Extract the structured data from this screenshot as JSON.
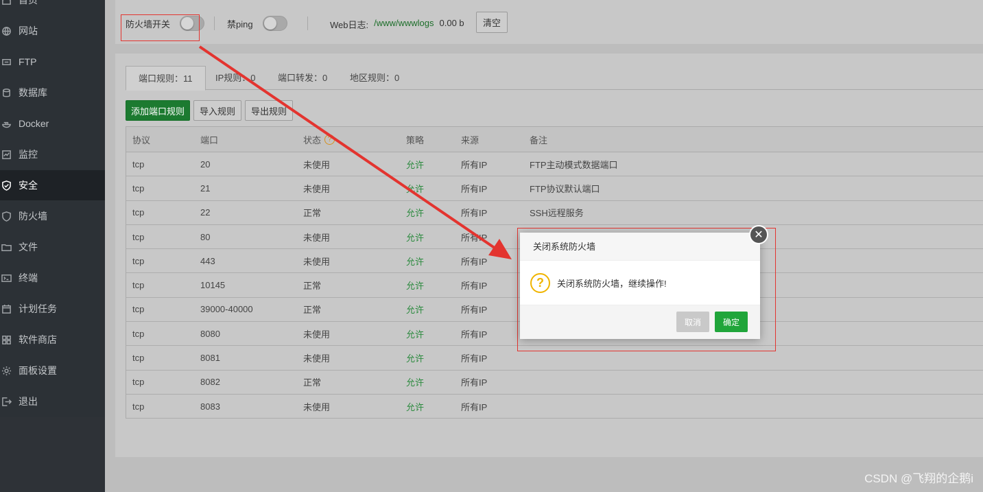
{
  "sidebar": {
    "items": [
      {
        "label": "首页",
        "icon": "home-icon"
      },
      {
        "label": "网站",
        "icon": "globe-icon"
      },
      {
        "label": "FTP",
        "icon": "ftp-icon"
      },
      {
        "label": "数据库",
        "icon": "database-icon"
      },
      {
        "label": "Docker",
        "icon": "docker-icon"
      },
      {
        "label": "监控",
        "icon": "monitor-icon"
      },
      {
        "label": "安全",
        "icon": "shield-check-icon"
      },
      {
        "label": "防火墙",
        "icon": "shield-icon"
      },
      {
        "label": "文件",
        "icon": "folder-icon"
      },
      {
        "label": "终端",
        "icon": "terminal-icon"
      },
      {
        "label": "计划任务",
        "icon": "calendar-icon"
      },
      {
        "label": "软件商店",
        "icon": "apps-icon"
      },
      {
        "label": "面板设置",
        "icon": "gear-icon"
      },
      {
        "label": "退出",
        "icon": "logout-icon"
      }
    ],
    "active": "安全"
  },
  "topbar": {
    "firewall_label": "防火墙开关",
    "firewall_on": false,
    "ping_label": "禁ping",
    "ping_on": false,
    "weblog_label": "Web日志:",
    "weblog_path": "/www/wwwlogs",
    "weblog_size": "0.00 b",
    "clear_label": "清空"
  },
  "tabs": [
    {
      "label": "端口规则：11"
    },
    {
      "label": "IP规则：0"
    },
    {
      "label": "端口转发：0"
    },
    {
      "label": "地区规则：0"
    }
  ],
  "actions": {
    "add": "添加端口规则",
    "import": "导入规则",
    "export": "导出规则"
  },
  "table": {
    "headers": [
      "协议",
      "端口",
      "状态",
      "策略",
      "来源",
      "备注"
    ],
    "help_glyph": "?",
    "rows": [
      {
        "proto": "tcp",
        "port": "20",
        "status": "未使用",
        "policy": "允许",
        "source": "所有IP",
        "note": "FTP主动模式数据端口"
      },
      {
        "proto": "tcp",
        "port": "21",
        "status": "未使用",
        "policy": "允许",
        "source": "所有IP",
        "note": "FTP协议默认端口"
      },
      {
        "proto": "tcp",
        "port": "22",
        "status": "正常",
        "policy": "允许",
        "source": "所有IP",
        "note": "SSH远程服务"
      },
      {
        "proto": "tcp",
        "port": "80",
        "status": "未使用",
        "policy": "允许",
        "source": "所有IP",
        "note": ""
      },
      {
        "proto": "tcp",
        "port": "443",
        "status": "未使用",
        "policy": "允许",
        "source": "所有IP",
        "note": ""
      },
      {
        "proto": "tcp",
        "port": "10145",
        "status": "正常",
        "policy": "允许",
        "source": "所有IP",
        "note": ""
      },
      {
        "proto": "tcp",
        "port": "39000-40000",
        "status": "正常",
        "policy": "允许",
        "source": "所有IP",
        "note": ""
      },
      {
        "proto": "tcp",
        "port": "8080",
        "status": "未使用",
        "policy": "允许",
        "source": "所有IP",
        "note": ""
      },
      {
        "proto": "tcp",
        "port": "8081",
        "status": "未使用",
        "policy": "允许",
        "source": "所有IP",
        "note": ""
      },
      {
        "proto": "tcp",
        "port": "8082",
        "status": "正常",
        "policy": "允许",
        "source": "所有IP",
        "note": ""
      },
      {
        "proto": "tcp",
        "port": "8083",
        "status": "未使用",
        "policy": "允许",
        "source": "所有IP",
        "note": ""
      }
    ]
  },
  "dialog": {
    "title": "关闭系统防火墙",
    "message": "关闭系统防火墙，继续操作!",
    "cancel": "取消",
    "ok": "确定",
    "close_glyph": "✕",
    "question_glyph": "?"
  },
  "colors": {
    "accent_green": "#20a53a",
    "annotation_red": "#e3342f"
  },
  "watermark": "CSDN @飞翔的企鹅i"
}
